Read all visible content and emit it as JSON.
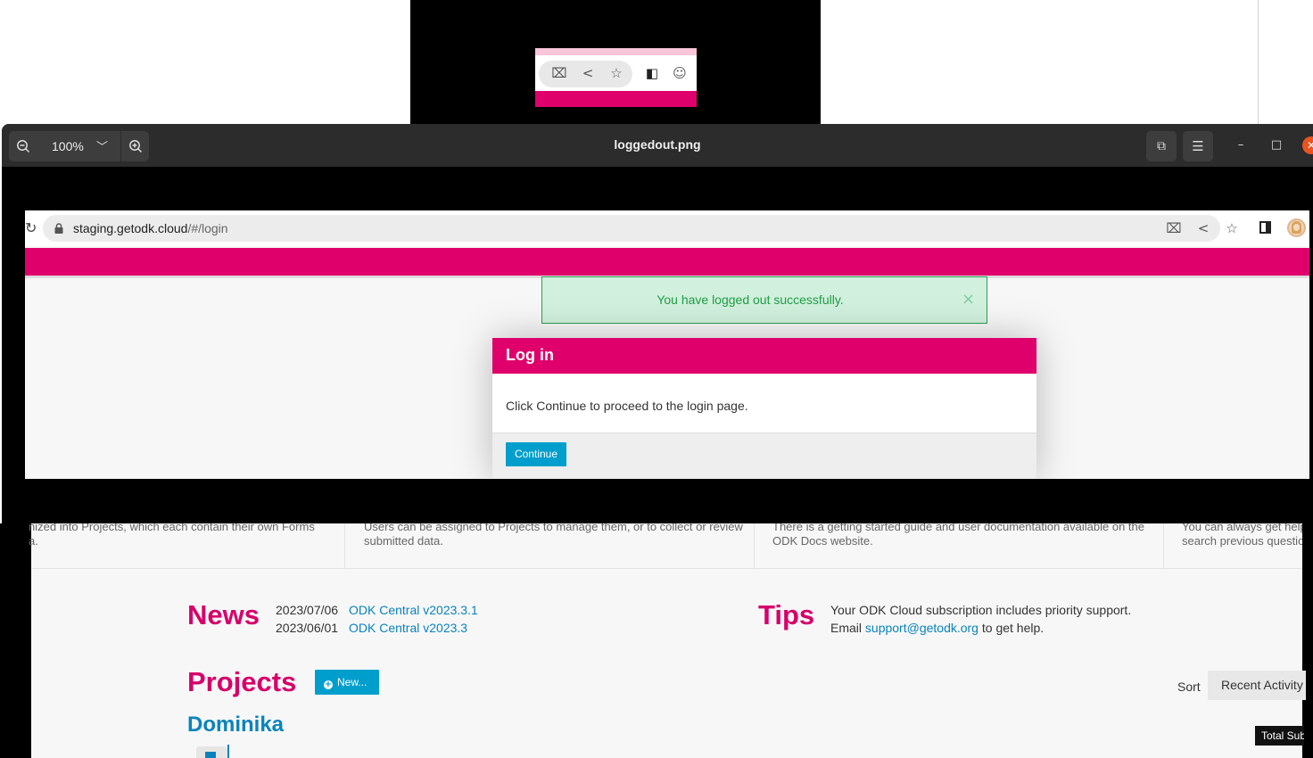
{
  "background_page": {
    "info_columns": [
      {
        "line1": "nized into Projects, which each contain their own Forms",
        "line2": "a."
      },
      {
        "line1": "Users can be assigned to Projects to manage them, or to collect or review",
        "line2": "submitted data."
      },
      {
        "line1": "There is a getting started guide and user documentation available on the",
        "line2": "ODK Docs website."
      },
      {
        "line1": "You can always get help",
        "line2": "search previous questio"
      }
    ],
    "news": {
      "title": "News",
      "items": [
        {
          "date": "2023/07/06",
          "label": "ODK Central v2023.3.1"
        },
        {
          "date": "2023/06/01",
          "label": "ODK Central v2023.3"
        }
      ]
    },
    "tips": {
      "title": "Tips",
      "line1": "Your ODK Cloud subscription includes priority support.",
      "line2_prefix": "Email ",
      "email": "support@getodk.org",
      "line2_suffix": " to get help."
    },
    "projects": {
      "title": "Projects",
      "new_button": "New...",
      "project_name": "Dominika",
      "sort_label": "Sort",
      "sort_value": "Recent Activity",
      "tooltip": "Total Sub"
    }
  },
  "viewer": {
    "zoom_level": "100%",
    "window_title": "loggedout.png"
  },
  "screenshot": {
    "url_host": "staging.getodk.cloud",
    "url_path": "/#/login",
    "alert_text": "You have logged out successfully.",
    "alert_close": "×",
    "modal": {
      "title": "Log in",
      "body": "Click Continue to proceed to the login page.",
      "button": "Continue"
    }
  },
  "colors": {
    "odk_pink": "#e0006b",
    "odk_blue": "#009ecc",
    "link_blue": "#0a83bc",
    "success_green": "#1f9e46",
    "ubuntu_orange": "#e95420"
  }
}
